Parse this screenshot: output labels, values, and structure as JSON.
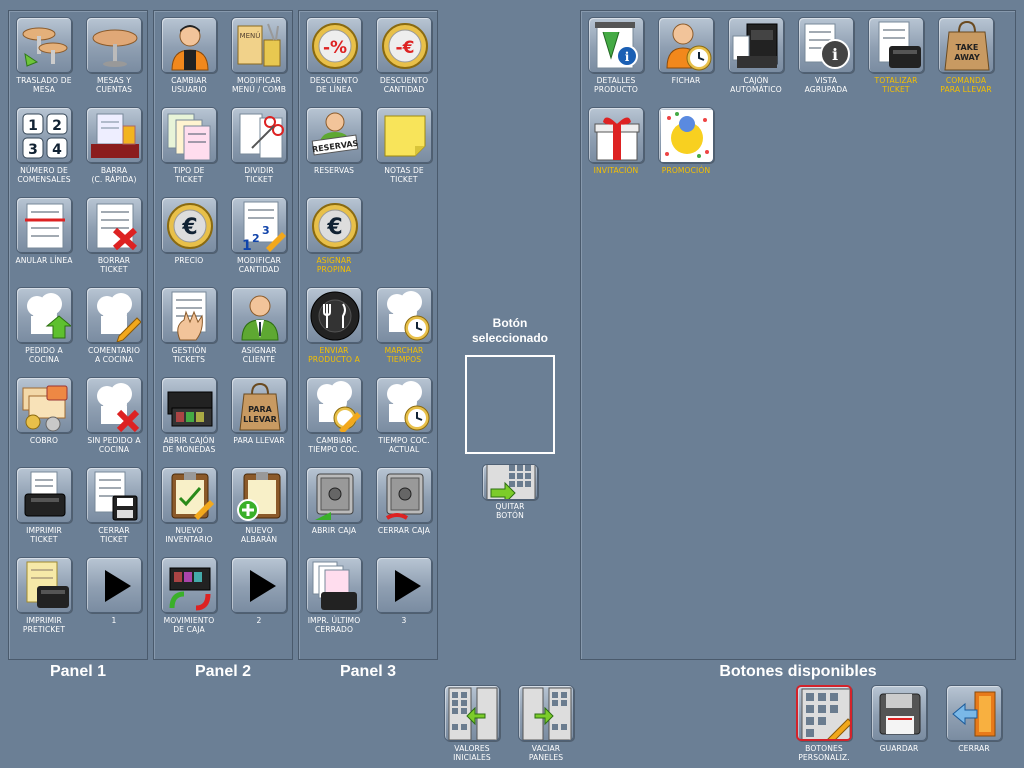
{
  "panels": {
    "panel1_title": "Panel 1",
    "panel2_title": "Panel 2",
    "panel3_title": "Panel 3",
    "available_title": "Botones disponibles"
  },
  "panel1": [
    {
      "label": "TRASLADO DE\nMESA",
      "icon": "tables-move-icon",
      "yellow": false
    },
    {
      "label": "MESAS Y\nCUENTAS",
      "icon": "table-icon",
      "yellow": false
    },
    {
      "label": "NÚMERO DE\nCOMENSALES",
      "icon": "diners-number-icon",
      "yellow": false
    },
    {
      "label": "BARRA\n(C. RÁPIDA)",
      "icon": "bar-icon",
      "yellow": false
    },
    {
      "label": "ANULAR LÍNEA",
      "icon": "cancel-line-icon",
      "yellow": false
    },
    {
      "label": "BORRAR\nTICKET",
      "icon": "delete-ticket-icon",
      "yellow": false
    },
    {
      "label": "PEDIDO A\nCOCINA",
      "icon": "kitchen-order-icon",
      "yellow": false
    },
    {
      "label": "COMENTARIO\nA COCINA",
      "icon": "kitchen-comment-icon",
      "yellow": false
    },
    {
      "label": "COBRO",
      "icon": "payment-icon",
      "yellow": false
    },
    {
      "label": "SIN PEDIDO A\nCOCINA",
      "icon": "no-kitchen-order-icon",
      "yellow": false
    },
    {
      "label": "IMPRIMIR\nTICKET",
      "icon": "print-ticket-icon",
      "yellow": false
    },
    {
      "label": "CERRAR\nTICKET",
      "icon": "close-ticket-icon",
      "yellow": false
    },
    {
      "label": "IMPRIMIR\nPRETICKET",
      "icon": "print-preticket-icon",
      "yellow": false
    },
    {
      "label": "1",
      "icon": "play-arrow-icon",
      "yellow": false
    }
  ],
  "panel2": [
    {
      "label": "CAMBIAR\nUSUARIO",
      "icon": "user-change-icon",
      "yellow": false
    },
    {
      "label": "MODIFICAR\nMENÚ / COMB",
      "icon": "menu-edit-icon",
      "yellow": false
    },
    {
      "label": "TIPO DE\nTICKET",
      "icon": "ticket-type-icon",
      "yellow": false
    },
    {
      "label": "DIVIDIR\nTICKET",
      "icon": "split-ticket-icon",
      "yellow": false
    },
    {
      "label": "PRECIO",
      "icon": "euro-price-icon",
      "yellow": false
    },
    {
      "label": "MODIFICAR\nCANTIDAD",
      "icon": "quantity-edit-icon",
      "yellow": false
    },
    {
      "label": "GESTIÓN\nTICKETS",
      "icon": "tickets-manage-icon",
      "yellow": false
    },
    {
      "label": "ASIGNAR\nCLIENTE",
      "icon": "assign-client-icon",
      "yellow": false
    },
    {
      "label": "ABRIR CAJÓN\nDE MONEDAS",
      "icon": "cash-drawer-icon",
      "yellow": false
    },
    {
      "label": "PARA LLEVAR",
      "icon": "takeaway-bag-icon",
      "yellow": false
    },
    {
      "label": "NUEVO\nINVENTARIO",
      "icon": "inventory-icon",
      "yellow": false
    },
    {
      "label": "NUEVO\nALBARÁN",
      "icon": "delivery-note-icon",
      "yellow": false
    },
    {
      "label": "MOVIMIENTO\nDE CAJA",
      "icon": "cash-movement-icon",
      "yellow": false
    },
    {
      "label": "2",
      "icon": "play-arrow-icon",
      "yellow": false
    }
  ],
  "panel3": [
    {
      "label": "DESCUENTO\nDE LÍNEA",
      "icon": "percent-discount-icon",
      "yellow": false
    },
    {
      "label": "DESCUENTO\nCANTIDAD",
      "icon": "euro-discount-icon",
      "yellow": false
    },
    {
      "label": "RESERVAS",
      "icon": "reservations-icon",
      "yellow": false
    },
    {
      "label": "NOTAS DE\nTICKET",
      "icon": "sticky-note-icon",
      "yellow": false
    },
    {
      "label": "ASIGNAR\nPROPINA",
      "icon": "euro-tip-icon",
      "yellow": true
    },
    {
      "label": "",
      "icon": "",
      "yellow": false
    },
    {
      "label": "ENVIAR\nPRODUCTO A",
      "icon": "plate-cutlery-icon",
      "yellow": true
    },
    {
      "label": "MARCHAR\nTIEMPOS",
      "icon": "chef-clock-icon",
      "yellow": true
    },
    {
      "label": "CAMBIAR\nTIEMPO COC.",
      "icon": "chef-clock-edit-icon",
      "yellow": false
    },
    {
      "label": "TIEMPO COC.\nACTUAL",
      "icon": "chef-clock-current-icon",
      "yellow": false
    },
    {
      "label": "ABRIR CAJA",
      "icon": "safe-open-icon",
      "yellow": false
    },
    {
      "label": "CERRAR CAJA",
      "icon": "safe-close-icon",
      "yellow": false
    },
    {
      "label": "IMPR. ÚLTIMO\nCERRADO",
      "icon": "print-last-icon",
      "yellow": false
    },
    {
      "label": "3",
      "icon": "play-arrow-icon",
      "yellow": false
    }
  ],
  "available": [
    {
      "label": "DETALLES\nPRODUCTO",
      "icon": "product-details-icon",
      "yellow": false
    },
    {
      "label": "FICHAR",
      "icon": "clock-in-icon",
      "yellow": false
    },
    {
      "label": "CAJÓN\nAUTOMÁTICO",
      "icon": "auto-drawer-icon",
      "yellow": false
    },
    {
      "label": "VISTA\nAGRUPADA",
      "icon": "grouped-view-icon",
      "yellow": false
    },
    {
      "label": "TOTALIZAR\nTICKET",
      "icon": "totalize-ticket-icon",
      "yellow": true
    },
    {
      "label": "COMANDA\nPARA LLEVAR",
      "icon": "takeaway-order-icon",
      "yellow": true
    },
    {
      "label": "INVITACIÓN",
      "icon": "gift-icon",
      "yellow": true
    },
    {
      "label": "PROMOCIÓN",
      "icon": "promotion-icon",
      "yellow": true
    }
  ],
  "selected": {
    "label": "Botón\nseleccionado",
    "remove_label": "QUITAR\nBOTÓN"
  },
  "bottom": {
    "initial_values": "VALORES\nINICIALES",
    "empty_panels": "VACIAR\nPANELES",
    "custom_buttons": "BOTONES\nPERSONALIZ.",
    "save": "GUARDAR",
    "close": "CERRAR"
  },
  "colors": {
    "background": "#6b7f95",
    "label_highlight": "#f5c000",
    "active_border": "#d4222a"
  }
}
